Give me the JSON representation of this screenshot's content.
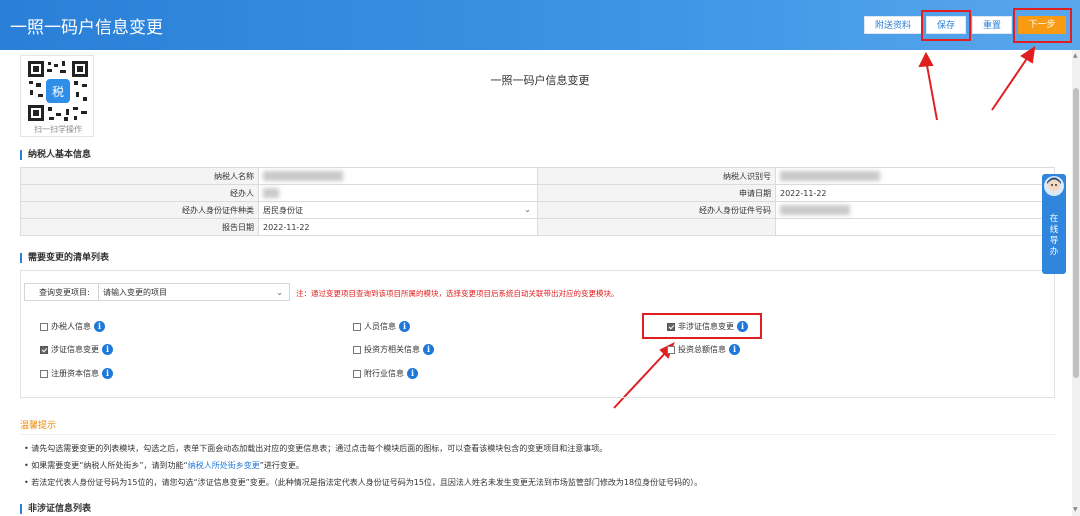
{
  "header": {
    "title": "一照一码户信息变更",
    "buttons": {
      "attach": "附送资料",
      "save": "保存",
      "reset": "重置",
      "next": "下一步"
    }
  },
  "qr": {
    "caption": "扫一扫学操作"
  },
  "page_title": "一照一码户信息变更",
  "taxpayer_section": {
    "title": "纳税人基本信息",
    "rows": [
      {
        "left_label": "纳税人名称",
        "left_value": "",
        "right_label": "纳税人识别号",
        "right_value": ""
      },
      {
        "left_label": "经办人",
        "left_value": "",
        "right_label": "申请日期",
        "right_value": "2022-11-22"
      },
      {
        "left_label": "经办人身份证件种类",
        "left_value": "居民身份证",
        "right_label": "经办人身份证件号码",
        "right_value": ""
      },
      {
        "left_label": "报告日期",
        "left_value": "2022-11-22",
        "right_label": "",
        "right_value": ""
      }
    ]
  },
  "change_list": {
    "title": "需要变更的清单列表",
    "query_label": "查询变更项目:",
    "query_placeholder": "请输入变更的项目",
    "note": "注：通过变更项目查询到该项目所属的模块，选择变更项目后系统自动关联带出对应的变更模块。",
    "items": [
      {
        "label": "办税人信息",
        "checked": false
      },
      {
        "label": "人员信息",
        "checked": false
      },
      {
        "label": "非涉证信息变更",
        "checked": true
      },
      {
        "label": "涉证信息变更",
        "checked": true
      },
      {
        "label": "投资方相关信息",
        "checked": false
      },
      {
        "label": "投资总额信息",
        "checked": false
      },
      {
        "label": "注册资本信息",
        "checked": false
      },
      {
        "label": "附行业信息",
        "checked": false
      }
    ]
  },
  "tips": {
    "title": "温馨提示",
    "line1": "• 请先勾选需要变更的列表模块，勾选之后，表单下面会动态加载出对应的变更信息表；通过点击每个模块后面的图标，可以查看该模块包含的变更项目和注意事项。",
    "line2_prefix": "• 如果需要变更“纳税人所处街乡”，请到功能“",
    "line2_link": "纳税人所处街乡变更",
    "line2_suffix": "”进行变更。",
    "line3": "• 若法定代表人身份证号码为15位的，请您勾选“涉证信息变更”变更。（此种情况是指法定代表人身份证号码为15位，且因法人姓名未发生变更无法到市场监管部门修改为18位身份证号码的）。"
  },
  "bottom_section": {
    "title": "非涉证信息列表"
  },
  "side_widget": {
    "text": "在线导办"
  },
  "icons": {
    "info": "info-icon",
    "chevron": "chevron-down-icon"
  },
  "colors": {
    "header_blue": "#2a7fd6",
    "next_orange": "#f99b12",
    "highlight_red": "#e02020",
    "info_blue": "#1e78d8"
  }
}
